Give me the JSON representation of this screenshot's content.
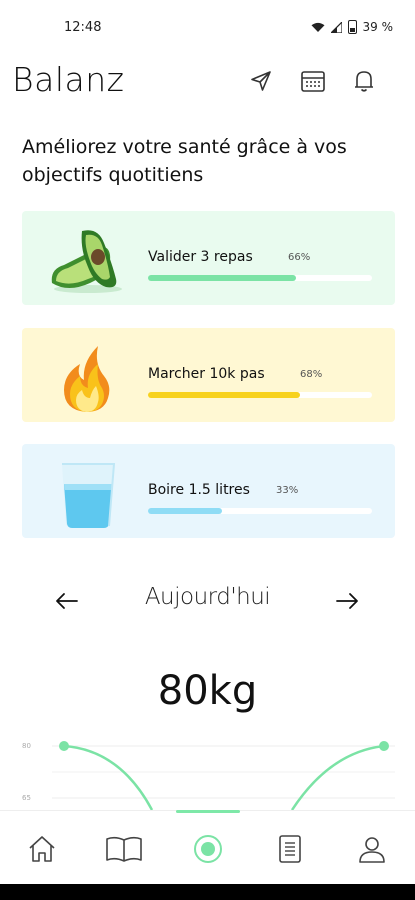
{
  "status": {
    "time": "12:48",
    "battery": "39 %"
  },
  "header": {
    "title": "Balanz",
    "icons": [
      "send-icon",
      "calendar-icon",
      "bell-icon"
    ]
  },
  "intro": "Améliorez votre santé grâce à vos objectifs quotitiens",
  "goals": [
    {
      "label": "Valider 3 repas",
      "percent": "66%",
      "progress": 0.66,
      "icon": "avocado-icon",
      "color": "#7be3a5",
      "bg": "#e9fbef"
    },
    {
      "label": "Marcher 10k pas",
      "percent": "68%",
      "progress": 0.68,
      "icon": "flame-icon",
      "color": "#f7d21e",
      "bg": "#fff8d3"
    },
    {
      "label": "Boire 1.5 litres",
      "percent": "33%",
      "progress": 0.33,
      "icon": "water-glass-icon",
      "color": "#8fdcf5",
      "bg": "#e8f6fd"
    }
  ],
  "day_nav": {
    "label": "Aujourd'hui"
  },
  "weight": {
    "value": "80kg"
  },
  "chart_data": {
    "type": "line",
    "y_ticks": [
      "80",
      "65"
    ],
    "line_color": "#7be3a5"
  },
  "tabs": [
    {
      "name": "home",
      "icon": "home-icon"
    },
    {
      "name": "journal",
      "icon": "book-icon"
    },
    {
      "name": "goals",
      "icon": "target-icon",
      "active": true
    },
    {
      "name": "notes",
      "icon": "document-icon"
    },
    {
      "name": "profile",
      "icon": "user-icon"
    }
  ]
}
